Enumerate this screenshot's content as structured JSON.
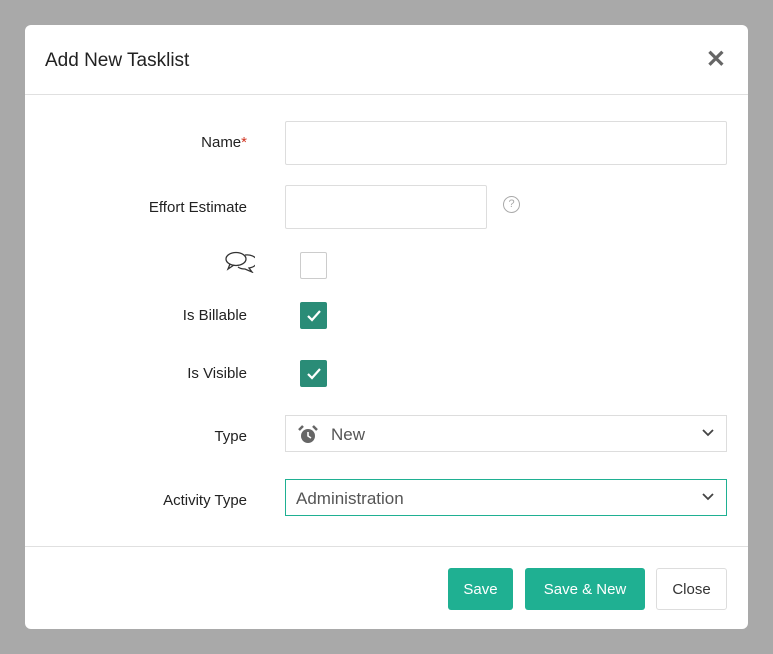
{
  "dialog": {
    "title": "Add New Tasklist"
  },
  "form": {
    "name_label": "Name",
    "required_mark": "*",
    "name_value": "",
    "effort_label": "Effort Estimate",
    "effort_value": "",
    "billable_label": "Is Billable",
    "billable_checked": true,
    "visible_label": "Is Visible",
    "visible_checked": true,
    "comments_checked": false,
    "type_label": "Type",
    "type_value": "New",
    "activity_label": "Activity Type",
    "activity_value": "Administration"
  },
  "footer": {
    "save": "Save",
    "save_new": "Save & New",
    "close": "Close"
  },
  "colors": {
    "accent": "#1fb092",
    "checkbox": "#2a8c77"
  }
}
